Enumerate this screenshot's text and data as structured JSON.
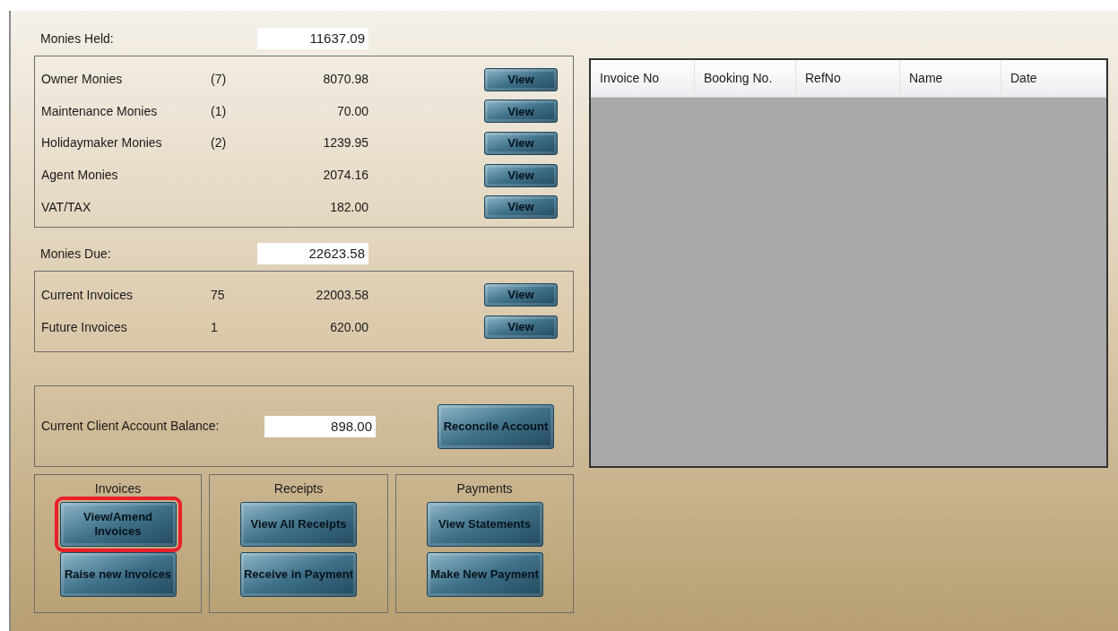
{
  "monies_held": {
    "label": "Monies Held:",
    "value": "11637.09"
  },
  "held_rows": [
    {
      "label": "Owner Monies",
      "count": "(7)",
      "amount": "8070.98",
      "button": "View"
    },
    {
      "label": "Maintenance Monies",
      "count": "(1)",
      "amount": "70.00",
      "button": "View"
    },
    {
      "label": "Holidaymaker Monies",
      "count": "(2)",
      "amount": "1239.95",
      "button": "View"
    },
    {
      "label": "Agent Monies",
      "amount": "2074.16",
      "button": "View"
    },
    {
      "label": "VAT/TAX",
      "amount": "182.00",
      "button": "View"
    }
  ],
  "monies_due": {
    "label": "Monies Due:",
    "value": "22623.58"
  },
  "due_rows": [
    {
      "label": "Current Invoices",
      "count": "75",
      "amount": "22003.58",
      "button": "View"
    },
    {
      "label": "Future Invoices",
      "count": "1",
      "amount": "620.00",
      "button": "View"
    }
  ],
  "balance": {
    "label": "Current Client Account Balance:",
    "value": "898.00",
    "button": "Reconcile Account"
  },
  "groups": [
    {
      "title": "Invoices",
      "buttons": [
        {
          "label": "View/Amend Invoices",
          "highlighted": true
        },
        {
          "label": "Raise new Invoices",
          "highlighted": false
        }
      ]
    },
    {
      "title": "Receipts",
      "buttons": [
        {
          "label": "View All Receipts",
          "highlighted": false
        },
        {
          "label": "Receive in Payment",
          "highlighted": false
        }
      ]
    },
    {
      "title": "Payments",
      "buttons": [
        {
          "label": "View Statements",
          "highlighted": false
        },
        {
          "label": "Make New Payment",
          "highlighted": false
        }
      ]
    }
  ],
  "table": {
    "columns": [
      "Invoice No",
      "Booking No.",
      "RefNo",
      "Name",
      "Date"
    ]
  }
}
